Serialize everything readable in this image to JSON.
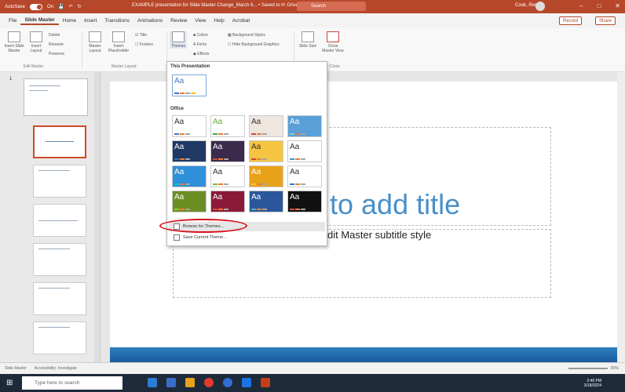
{
  "titlebar": {
    "autosave_label": "AutoSave",
    "autosave_state": "On",
    "filename": "EXAMPLE presentation for Slide Master Change_March 6... • Saved to H: Drive",
    "search_placeholder": "Search",
    "user_name": "Cook, Renee",
    "accent": "#b7472a"
  },
  "tabs": [
    "File",
    "Slide Master",
    "Home",
    "Insert",
    "Transitions",
    "Animations",
    "Review",
    "View",
    "Help",
    "Acrobat"
  ],
  "active_tab": "Slide Master",
  "record_label": "Record",
  "share_label": "Share",
  "ribbon": {
    "insert_slide_master": "Insert Slide Master",
    "insert_layout": "Insert Layout",
    "delete": "Delete",
    "rename": "Rename",
    "preserve": "Preserve",
    "master_layout": "Master Layout",
    "insert_placeholder": "Insert Placeholder",
    "title": "Title",
    "footers": "Footers",
    "themes": "Themes",
    "colors": "Colors",
    "fonts": "Fonts",
    "effects": "Effects",
    "background_styles": "Background Styles",
    "hide_background_graphics": "Hide Background Graphics",
    "slide_size": "Slide Size",
    "close_master_view": "Close Master View",
    "group_edit_master": "Edit Master",
    "group_master_layout": "Master Layout",
    "group_close": "Close"
  },
  "dropdown": {
    "section_this_presentation": "This Presentation",
    "section_office": "Office",
    "browse_themes": "Browse for Themes...",
    "save_current_theme": "Save Current Theme..."
  },
  "slide": {
    "title_text": "to add title",
    "subtitle_text": "dit Master subtitle style"
  },
  "thumbnails": {
    "slide_number": "1"
  },
  "status": {
    "view": "Slide Master",
    "accessibility": "Accessibility: Investigate",
    "zoom": "80%"
  },
  "taskbar": {
    "search_placeholder": "Type here to search",
    "time": "2:46 PM",
    "date": "3/18/2024"
  }
}
